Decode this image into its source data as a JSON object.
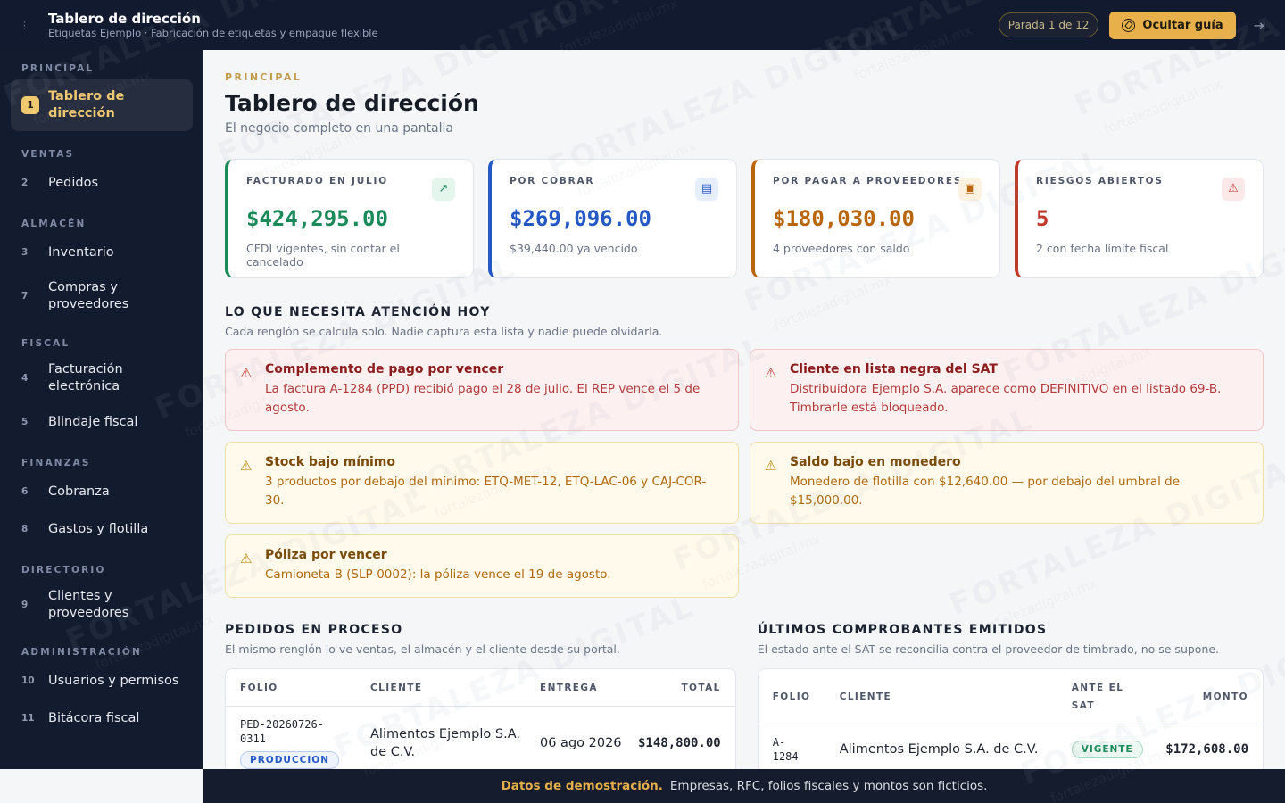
{
  "header": {
    "menu_icon": "menu-icon",
    "title": "Tablero de dirección",
    "subtitle": "Etiquetas Ejemplo · Fabricación de etiquetas y empaque flexible",
    "stop_label": "Parada 1 de 12",
    "guide_button": "Ocultar guía",
    "logout_icon": "logout-icon"
  },
  "sidebar": {
    "sections": [
      {
        "label": "PRINCIPAL",
        "items": [
          {
            "num": "1",
            "label": "Tablero de dirección",
            "active": true
          }
        ]
      },
      {
        "label": "VENTAS",
        "items": [
          {
            "num": "2",
            "label": "Pedidos"
          }
        ]
      },
      {
        "label": "ALMACÉN",
        "items": [
          {
            "num": "3",
            "label": "Inventario"
          },
          {
            "num": "7",
            "label": "Compras y proveedores"
          }
        ]
      },
      {
        "label": "FISCAL",
        "items": [
          {
            "num": "4",
            "label": "Facturación electrónica"
          },
          {
            "num": "5",
            "label": "Blindaje fiscal"
          }
        ]
      },
      {
        "label": "FINANZAS",
        "items": [
          {
            "num": "6",
            "label": "Cobranza"
          },
          {
            "num": "8",
            "label": "Gastos y flotilla"
          }
        ]
      },
      {
        "label": "DIRECTORIO",
        "items": [
          {
            "num": "9",
            "label": "Clientes y proveedores"
          }
        ]
      },
      {
        "label": "ADMINISTRACIÓN",
        "items": [
          {
            "num": "10",
            "label": "Usuarios y permisos"
          },
          {
            "num": "11",
            "label": "Bitácora fiscal"
          }
        ]
      }
    ]
  },
  "main": {
    "eyebrow": "PRINCIPAL",
    "title": "Tablero de dirección",
    "subtitle": "El negocio completo en una pantalla",
    "kpis": [
      {
        "label": "FACTURADO EN JULIO",
        "value": "$424,295.00",
        "note": "CFDI vigentes, sin contar el cancelado",
        "color": "#1a8a5a",
        "icon": "trending-up-icon",
        "glyph": "↗",
        "icon_bg": "#e4f5ec"
      },
      {
        "label": "POR COBRAR",
        "value": "$269,096.00",
        "note": "$39,440.00 ya vencido",
        "color": "#2458c4",
        "icon": "document-icon",
        "glyph": "▤",
        "icon_bg": "#e6eefb"
      },
      {
        "label": "POR PAGAR A PROVEEDORES",
        "value": "$180,030.00",
        "note": "4 proveedores con saldo",
        "color": "#b8650c",
        "icon": "wallet-icon",
        "glyph": "▣",
        "icon_bg": "#fdf1e2"
      },
      {
        "label": "RIESGOS ABIERTOS",
        "value": "5",
        "note": "2 con fecha límite fiscal",
        "color": "#c0392b",
        "icon": "warning-icon",
        "glyph": "⚠",
        "icon_bg": "#fbe9e9"
      }
    ],
    "attention": {
      "title": "LO QUE NECESITA ATENCIÓN HOY",
      "subtitle": "Cada renglón se calcula solo. Nadie captura esta lista y nadie puede olvidarla.",
      "alerts": [
        {
          "level": "red",
          "title": "Complemento de pago por vencer",
          "text": "La factura A-1284 (PPD) recibió pago el 28 de julio. El REP vence el 5 de agosto."
        },
        {
          "level": "red",
          "title": "Cliente en lista negra del SAT",
          "text": "Distribuidora Ejemplo S.A. aparece como DEFINITIVO en el listado 69-B. Timbrarle está bloqueado."
        },
        {
          "level": "amber",
          "title": "Stock bajo mínimo",
          "text": "3 productos por debajo del mínimo: ETQ-MET-12, ETQ-LAC-06 y CAJ-COR-30."
        },
        {
          "level": "amber",
          "title": "Saldo bajo en monedero",
          "text": "Monedero de flotilla con $12,640.00 — por debajo del umbral de $15,000.00."
        },
        {
          "level": "amber",
          "title": "Póliza por vencer",
          "text": "Camioneta B (SLP-0002): la póliza vence el 19 de agosto."
        }
      ]
    },
    "orders": {
      "title": "PEDIDOS EN PROCESO",
      "subtitle": "El mismo renglón lo ve ventas, el almacén y el cliente desde su portal.",
      "columns": [
        "FOLIO",
        "CLIENTE",
        "ENTREGA",
        "TOTAL"
      ],
      "rows": [
        {
          "folio": "PED-20260726-0311",
          "status": "PRODUCCION",
          "client": "Alimentos Ejemplo S.A. de C.V.",
          "delivery": "06 ago 2026",
          "total": "$148,800.00"
        }
      ]
    },
    "invoices": {
      "title": "ÚLTIMOS COMPROBANTES EMITIDOS",
      "subtitle": "El estado ante el SAT se reconcilia contra el proveedor de timbrado, no se supone.",
      "columns": [
        "FOLIO",
        "CLIENTE",
        "ANTE EL SAT",
        "MONTO"
      ],
      "rows": [
        {
          "folio": "A-1284",
          "client": "Alimentos Ejemplo S.A. de C.V.",
          "status": "VIGENTE",
          "amount": "$172,608.00"
        }
      ]
    }
  },
  "footer": {
    "bold": "Datos de demostración.",
    "text": "Empresas, RFC, folios fiscales y montos son ficticios."
  },
  "watermark": {
    "brand": "FORTALEZA DIGITAL",
    "site": "fortalezadigital.mx"
  }
}
